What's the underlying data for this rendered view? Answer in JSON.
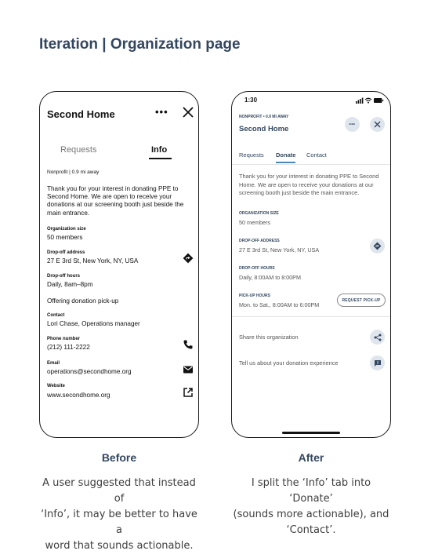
{
  "page_title": "Iteration | Organization page",
  "before": {
    "caption": "Before",
    "description_lines": [
      "A user suggested that instead of",
      "‘Info’, it may be better to have a",
      "word that sounds actionable."
    ],
    "org_name": "Second Home",
    "more_icon": "•••",
    "tabs": [
      "Requests",
      "Info"
    ],
    "meta": "Nonprofit  |  0.9 mi away",
    "description": "Thank you for your interest in donating PPE to Second Home. We are open to receive your donations at our screening booth just beside the main entrance.",
    "org_size_label": "Organization size",
    "org_size_value": "50 members",
    "dropoff_label": "Drop-off address",
    "dropoff_value": "27 E 3rd St, New York, NY, USA",
    "hours_label": "Drop-off hours",
    "hours_value": "Daily, 8am–8pm",
    "pickup_note": "Offering donation pick-up",
    "contact_label": "Contact",
    "contact_value": "Lori Chase, Operations manager",
    "phone_label": "Phone number",
    "phone_value": "(212) 111-2222",
    "email_label": "Email",
    "email_value": "operations@secondhome.org",
    "website_label": "Website",
    "website_value": "www.secondhome.org",
    "icons": [
      "close-icon",
      "directions-icon",
      "phone-icon",
      "mail-icon",
      "external-link-icon"
    ]
  },
  "after": {
    "caption": "After",
    "description_lines": [
      "I split the ‘Info’ tab into ‘Donate’",
      "(sounds more actionable), and",
      "‘Contact’."
    ],
    "time": "1:30",
    "meta": "NONPROFIT • 0.9 MI AWAY",
    "org_name": "Second Home",
    "more_icon": "•••",
    "tabs": [
      "Requests",
      "Donate",
      "Contact"
    ],
    "description": "Thank you for your interest in donating PPE to Second Home. We are open to receive your donations at our screening booth just beside the main entrance.",
    "org_size_label": "ORGANIZATION SIZE",
    "org_size_value": "50 members",
    "dropoff_label": "DROP-OFF ADDRESS",
    "dropoff_value": "27 E 3rd St, New York, NY, USA",
    "dropoff_hours_label": "DROP-OFF HOURS",
    "dropoff_hours_value": "Daily, 8:00AM to 8:00PM",
    "pickup_hours_label": "PICK-UP HOURS",
    "pickup_hours_value": "Mon. to Sat., 8:00AM to 6:00PM",
    "request_pickup_button": "REQUEST PICK-UP",
    "share_label": "Share this organization",
    "feedback_label": "Tell us about your donation experience",
    "icons": [
      "signal-icon",
      "wifi-icon",
      "battery-icon",
      "more-icon",
      "close-icon",
      "directions-icon",
      "share-icon",
      "feedback-icon"
    ],
    "accent_color": "#4a88b8",
    "text_color": "#34475f"
  }
}
